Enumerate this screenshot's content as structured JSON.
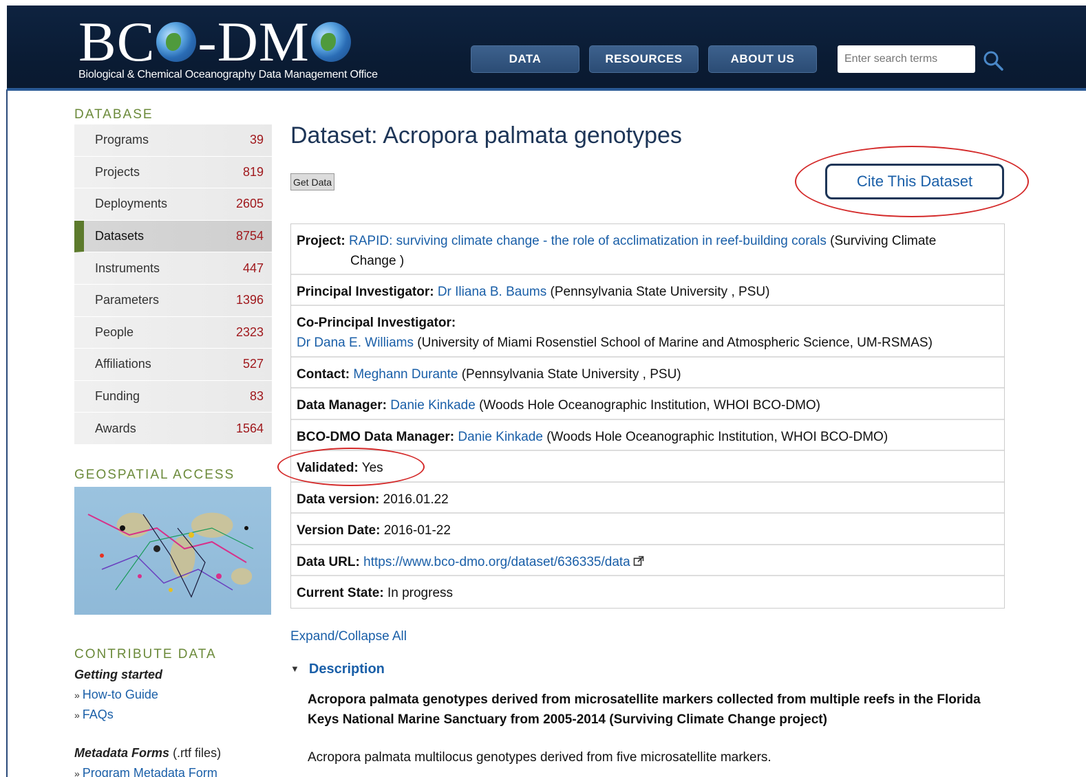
{
  "header": {
    "logo_text": "BCO-DMO",
    "tagline": "Biological & Chemical Oceanography Data Management Office",
    "nav": [
      "DATA",
      "RESOURCES",
      "ABOUT US"
    ],
    "search_placeholder": "Enter search terms"
  },
  "sidebar": {
    "database_title": "DATABASE",
    "items": [
      {
        "label": "Programs",
        "count": "39"
      },
      {
        "label": "Projects",
        "count": "819"
      },
      {
        "label": "Deployments",
        "count": "2605"
      },
      {
        "label": "Datasets",
        "count": "8754"
      },
      {
        "label": "Instruments",
        "count": "447"
      },
      {
        "label": "Parameters",
        "count": "1396"
      },
      {
        "label": "People",
        "count": "2323"
      },
      {
        "label": "Affiliations",
        "count": "527"
      },
      {
        "label": "Funding",
        "count": "83"
      },
      {
        "label": "Awards",
        "count": "1564"
      }
    ],
    "geospatial_title": "GEOSPATIAL ACCESS",
    "contribute_title": "CONTRIBUTE DATA",
    "getting_started": "Getting started",
    "howto": "How-to Guide",
    "faqs": "FAQs",
    "metadata_forms": "Metadata Forms",
    "metadata_forms_note": "(.rtf files)",
    "program_form": "Program Metadata Form"
  },
  "main": {
    "title": "Dataset: Acropora palmata genotypes",
    "get_data": "Get Data",
    "cite": "Cite This Dataset",
    "rows": {
      "project_label": "Project:",
      "project_link": "RAPID: surviving climate change - the role of acclimatization in reef-building corals",
      "project_rest": "(Surviving Climate",
      "project_rest2": "Change )",
      "pi_label": "Principal Investigator:",
      "pi_link": "Dr Iliana B. Baums",
      "pi_rest": "(Pennsylvania State University , PSU)",
      "copi_label": "Co-Principal Investigator:",
      "copi_link": "Dr Dana E. Williams",
      "copi_rest": "(University of Miami Rosenstiel School of Marine and Atmospheric Science, UM-RSMAS)",
      "contact_label": "Contact:",
      "contact_link": "Meghann Durante",
      "contact_rest": "(Pennsylvania State University , PSU)",
      "dm_label": "Data Manager:",
      "dm_link": "Danie Kinkade",
      "dm_rest": "(Woods Hole Oceanographic Institution, WHOI BCO-DMO)",
      "bdm_label": "BCO-DMO Data Manager:",
      "bdm_link": "Danie Kinkade",
      "bdm_rest": "(Woods Hole Oceanographic Institution, WHOI BCO-DMO)",
      "validated_label": "Validated:",
      "validated_value": "Yes",
      "version_label": "Data version:",
      "version_value": "2016.01.22",
      "vdate_label": "Version Date:",
      "vdate_value": "2016-01-22",
      "url_label": "Data URL:",
      "url_link": "https://www.bco-dmo.org/dataset/636335/data",
      "state_label": "Current State:",
      "state_value": "In progress"
    },
    "expand": "Expand/Collapse All",
    "description_head": "Description",
    "description_bold": "Acropora palmata genotypes derived from microsatellite markers collected from multiple reefs in the Florida Keys National Marine Sanctuary from 2005-2014 (Surviving Climate Change project)",
    "description_text": "Acropora palmata multilocus genotypes derived from five microsatellite markers."
  },
  "colors": {
    "annotation": "#d42a2a",
    "link": "#1a5fa8",
    "header": "#0e2340",
    "accent_green": "#5c7a2c"
  }
}
